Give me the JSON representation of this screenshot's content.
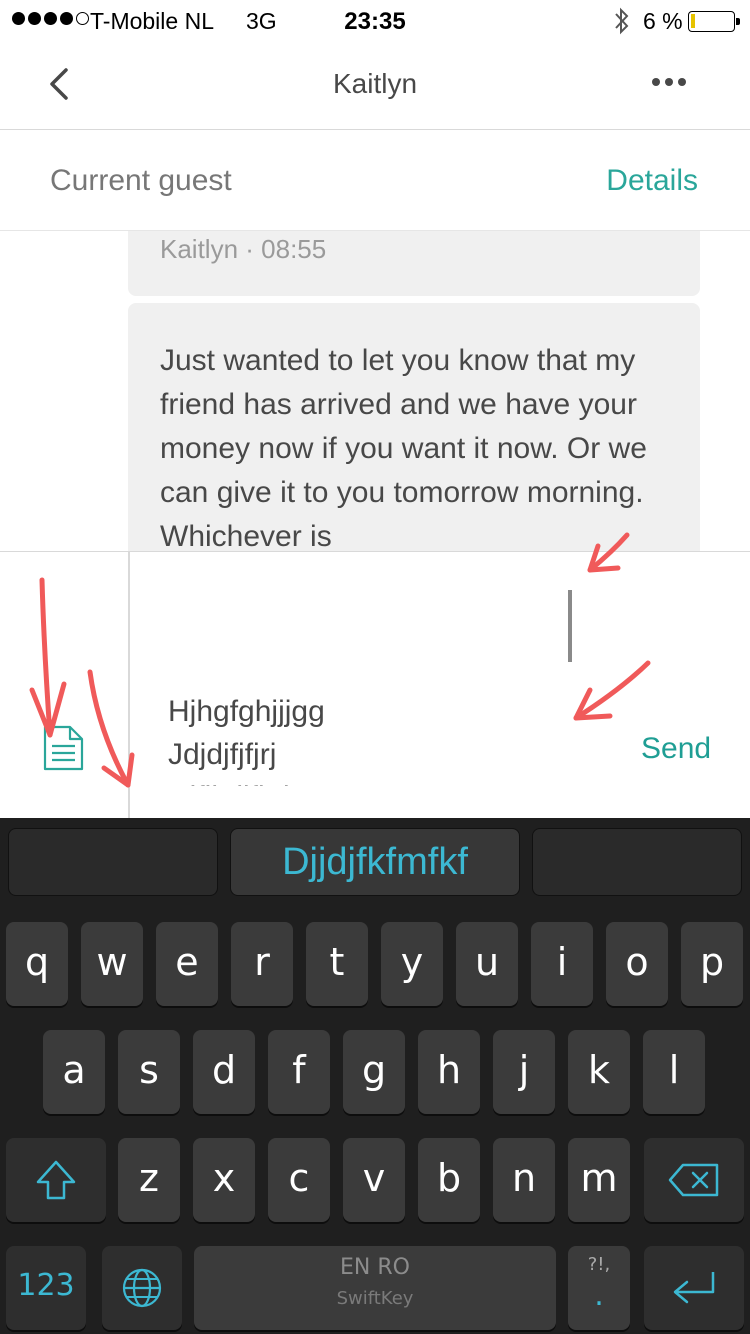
{
  "status_bar": {
    "carrier": "T-Mobile NL",
    "network": "3G",
    "time": "23:35",
    "battery_percent": "6 %",
    "battery_level": 0.06,
    "signal_bars": 4
  },
  "nav": {
    "title": "Kaitlyn"
  },
  "guest_bar": {
    "label": "Current guest",
    "details_link": "Details"
  },
  "messages": [
    {
      "meta": "Kaitlyn · 08:55"
    },
    {
      "text": "Just wanted to let you know that my friend has arrived and we have your money now if you want it now. Or we can give it to you tomorrow morning. Whichever is"
    }
  ],
  "composer": {
    "input_value": "Hjhgfghjjjgg\nJdjdjfjfjrj\nDjfjkdjfkdm",
    "send_label": "Send"
  },
  "keyboard": {
    "suggestions": [
      "",
      "Djjdjfkfmfkf",
      ""
    ],
    "row1": [
      "q",
      "w",
      "e",
      "r",
      "t",
      "y",
      "u",
      "i",
      "o",
      "p"
    ],
    "row2": [
      "a",
      "s",
      "d",
      "f",
      "g",
      "h",
      "j",
      "k",
      "l"
    ],
    "row3": [
      "z",
      "x",
      "c",
      "v",
      "b",
      "n",
      "m"
    ],
    "numbers_label": "123",
    "space_language": "EN RO",
    "space_brand": "SwiftKey",
    "punct_top": "?!,",
    "punct_main": ".",
    "accent_color": "#3cb8d2"
  },
  "colors": {
    "accent": "#2aa69a",
    "annotation_arrow": "#f05a5a"
  },
  "icons": [
    "back-chevron-icon",
    "more-dots-icon",
    "bluetooth-icon",
    "battery-icon",
    "template-document-icon",
    "shift-icon",
    "backspace-icon",
    "globe-icon",
    "return-icon"
  ]
}
